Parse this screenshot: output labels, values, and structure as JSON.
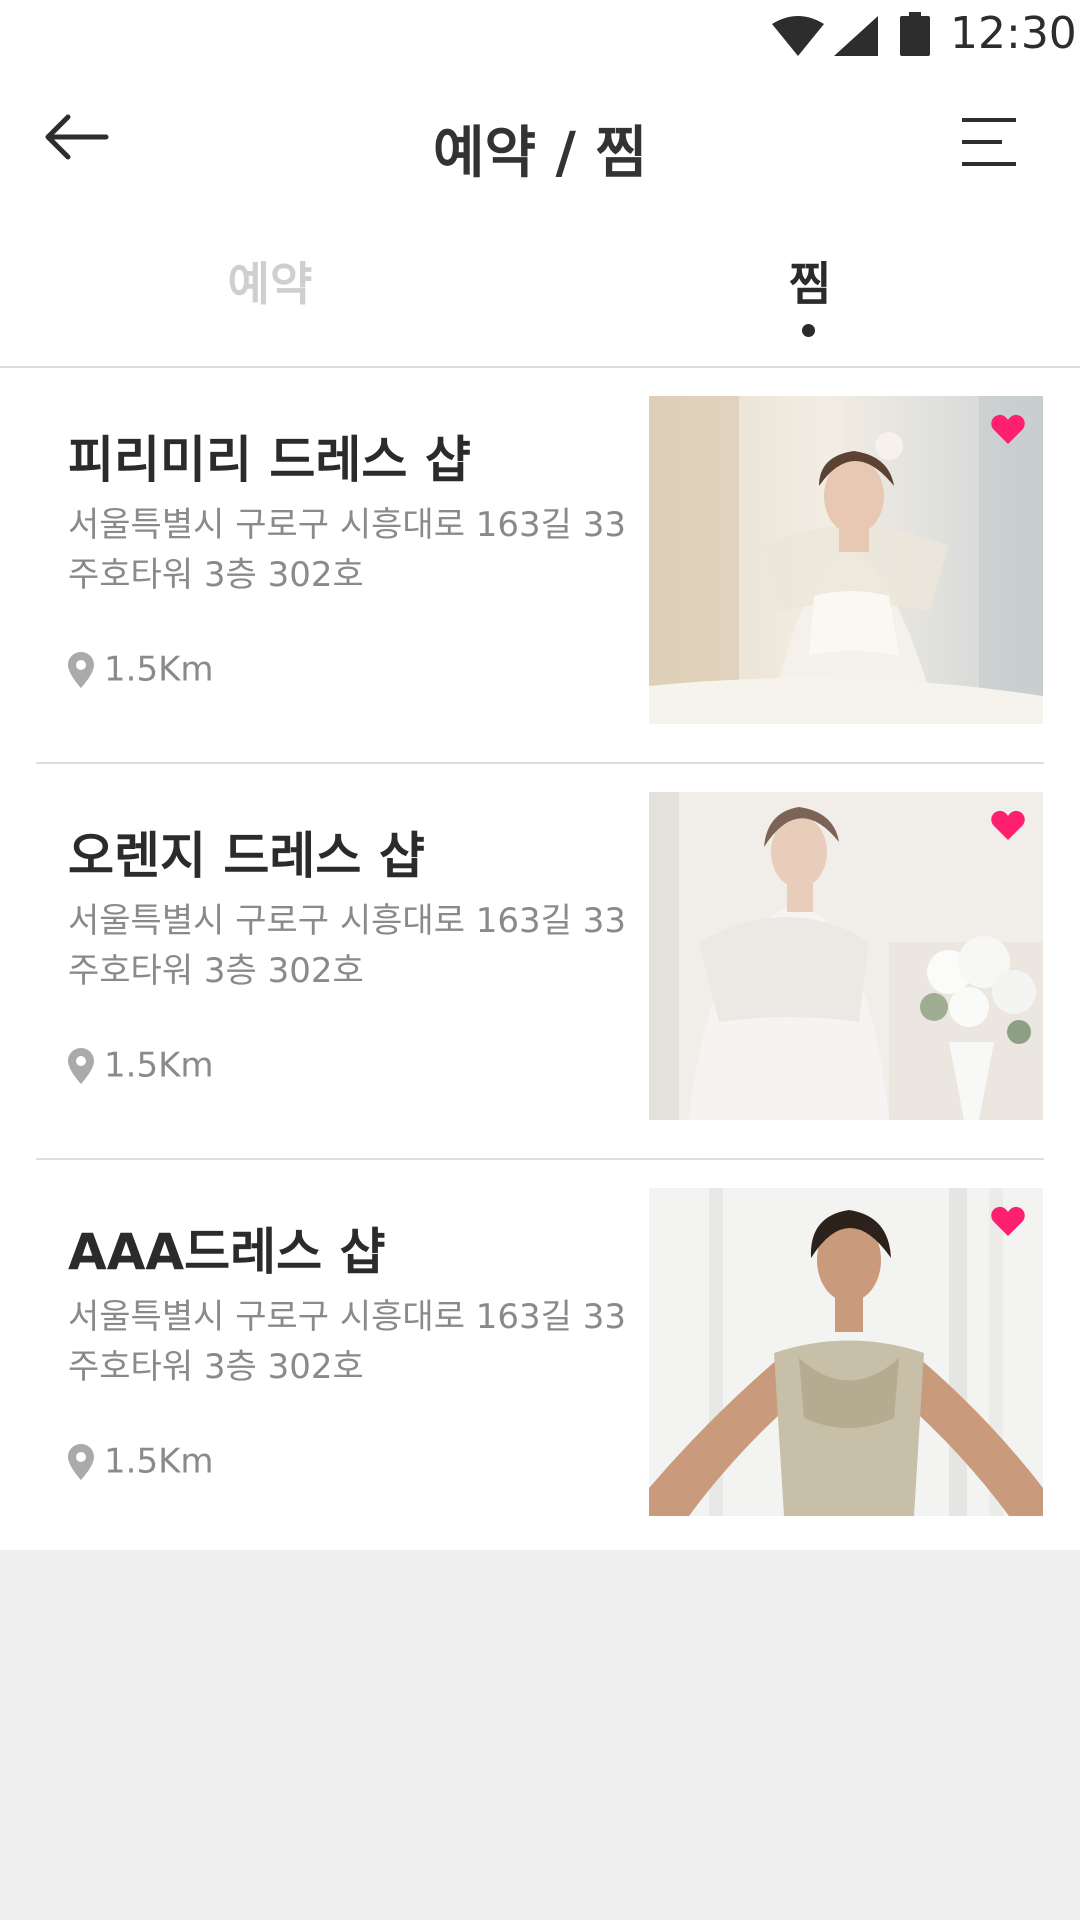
{
  "status_bar": {
    "time": "12:30"
  },
  "header": {
    "title": "예약 / 찜"
  },
  "tabs": [
    {
      "label": "예약",
      "active": false
    },
    {
      "label": "찜",
      "active": true
    }
  ],
  "shops": [
    {
      "name": "피리미리 드레스 샵",
      "address_line1": "서울특별시 구로구 시흥대로 163길 33",
      "address_line2": "주호타워 3층 302호",
      "distance": "1.5Km",
      "favorited": true
    },
    {
      "name": "오렌지 드레스 샵",
      "address_line1": "서울특별시 구로구 시흥대로 163길 33",
      "address_line2": "주호타워 3층 302호",
      "distance": "1.5Km",
      "favorited": true
    },
    {
      "name": "AAA드레스 샵",
      "address_line1": "서울특별시 구로구 시흥대로 163길 33",
      "address_line2": "주호타워 3층 302호",
      "distance": "1.5Km",
      "favorited": true
    }
  ],
  "colors": {
    "heart": "#ff1f6f",
    "text_primary": "#2b2b2b",
    "text_secondary": "#8a8a8a",
    "tab_inactive": "#cfcfcf"
  }
}
